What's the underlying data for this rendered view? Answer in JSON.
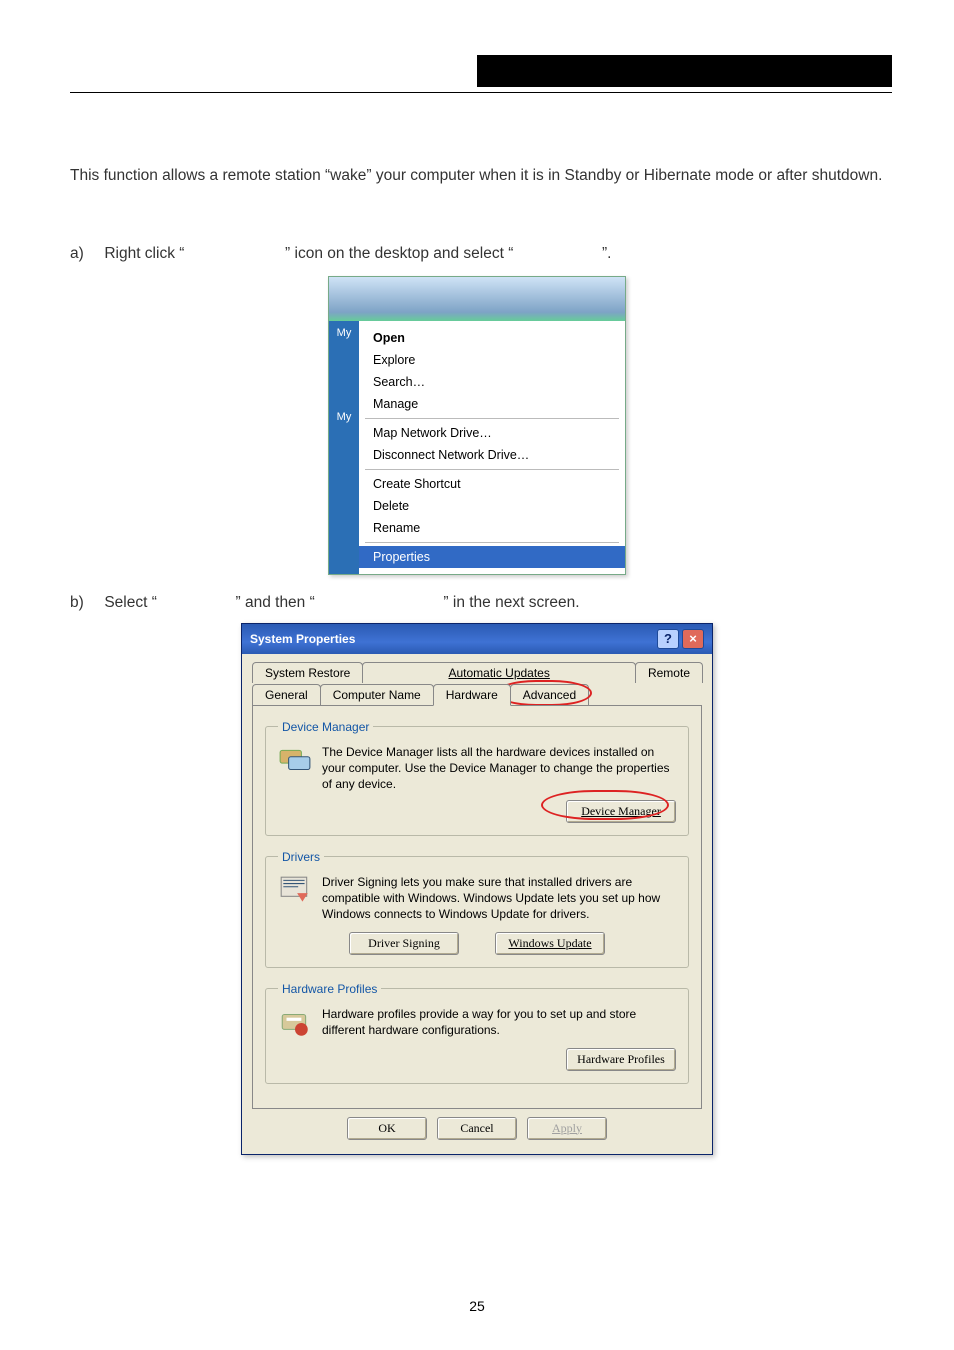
{
  "black_box": "",
  "intro_text": "This function allows a remote station “wake” your computer when it is in Standby or Hibernate mode or after shutdown.",
  "step_a": {
    "letter": "a)",
    "t1": "Right click “",
    "t2": "” icon on the desktop and select “",
    "t3": "”."
  },
  "step_b": {
    "letter": "b)",
    "t1": "Select “",
    "t2": "” and then “",
    "t3": "” in the next screen."
  },
  "ctx": {
    "left_label_1": "My",
    "left_label_2": "My",
    "items": {
      "open": "Open",
      "explore": "Explore",
      "search": "Search…",
      "manage": "Manage",
      "map": "Map Network Drive…",
      "disconnect": "Disconnect Network Drive…",
      "shortcut": "Create Shortcut",
      "delete": "Delete",
      "rename": "Rename",
      "properties": "Properties"
    }
  },
  "dlg": {
    "title": "System Properties",
    "help": "?",
    "close": "×",
    "tabs_back": {
      "restore": "System Restore",
      "updates": "Automatic Updates",
      "remote": "Remote"
    },
    "tabs_front": {
      "general": "General",
      "cname": "Computer Name",
      "hardware": "Hardware",
      "advanced": "Advanced"
    },
    "devmgr": {
      "legend": "Device Manager",
      "text": "The Device Manager lists all the hardware devices installed on your computer. Use the Device Manager to change the properties of any device.",
      "btn": "Device Manager"
    },
    "drivers": {
      "legend": "Drivers",
      "text": "Driver Signing lets you make sure that installed drivers are compatible with Windows. Windows Update lets you set up how Windows connects to Windows Update for drivers.",
      "btn1": "Driver Signing",
      "btn2": "Windows Update"
    },
    "hwp": {
      "legend": "Hardware Profiles",
      "text": "Hardware profiles provide a way for you to set up and store different hardware configurations.",
      "btn": "Hardware Profiles"
    },
    "buttons": {
      "ok": "OK",
      "cancel": "Cancel",
      "apply": "Apply"
    }
  },
  "page_number": "25"
}
